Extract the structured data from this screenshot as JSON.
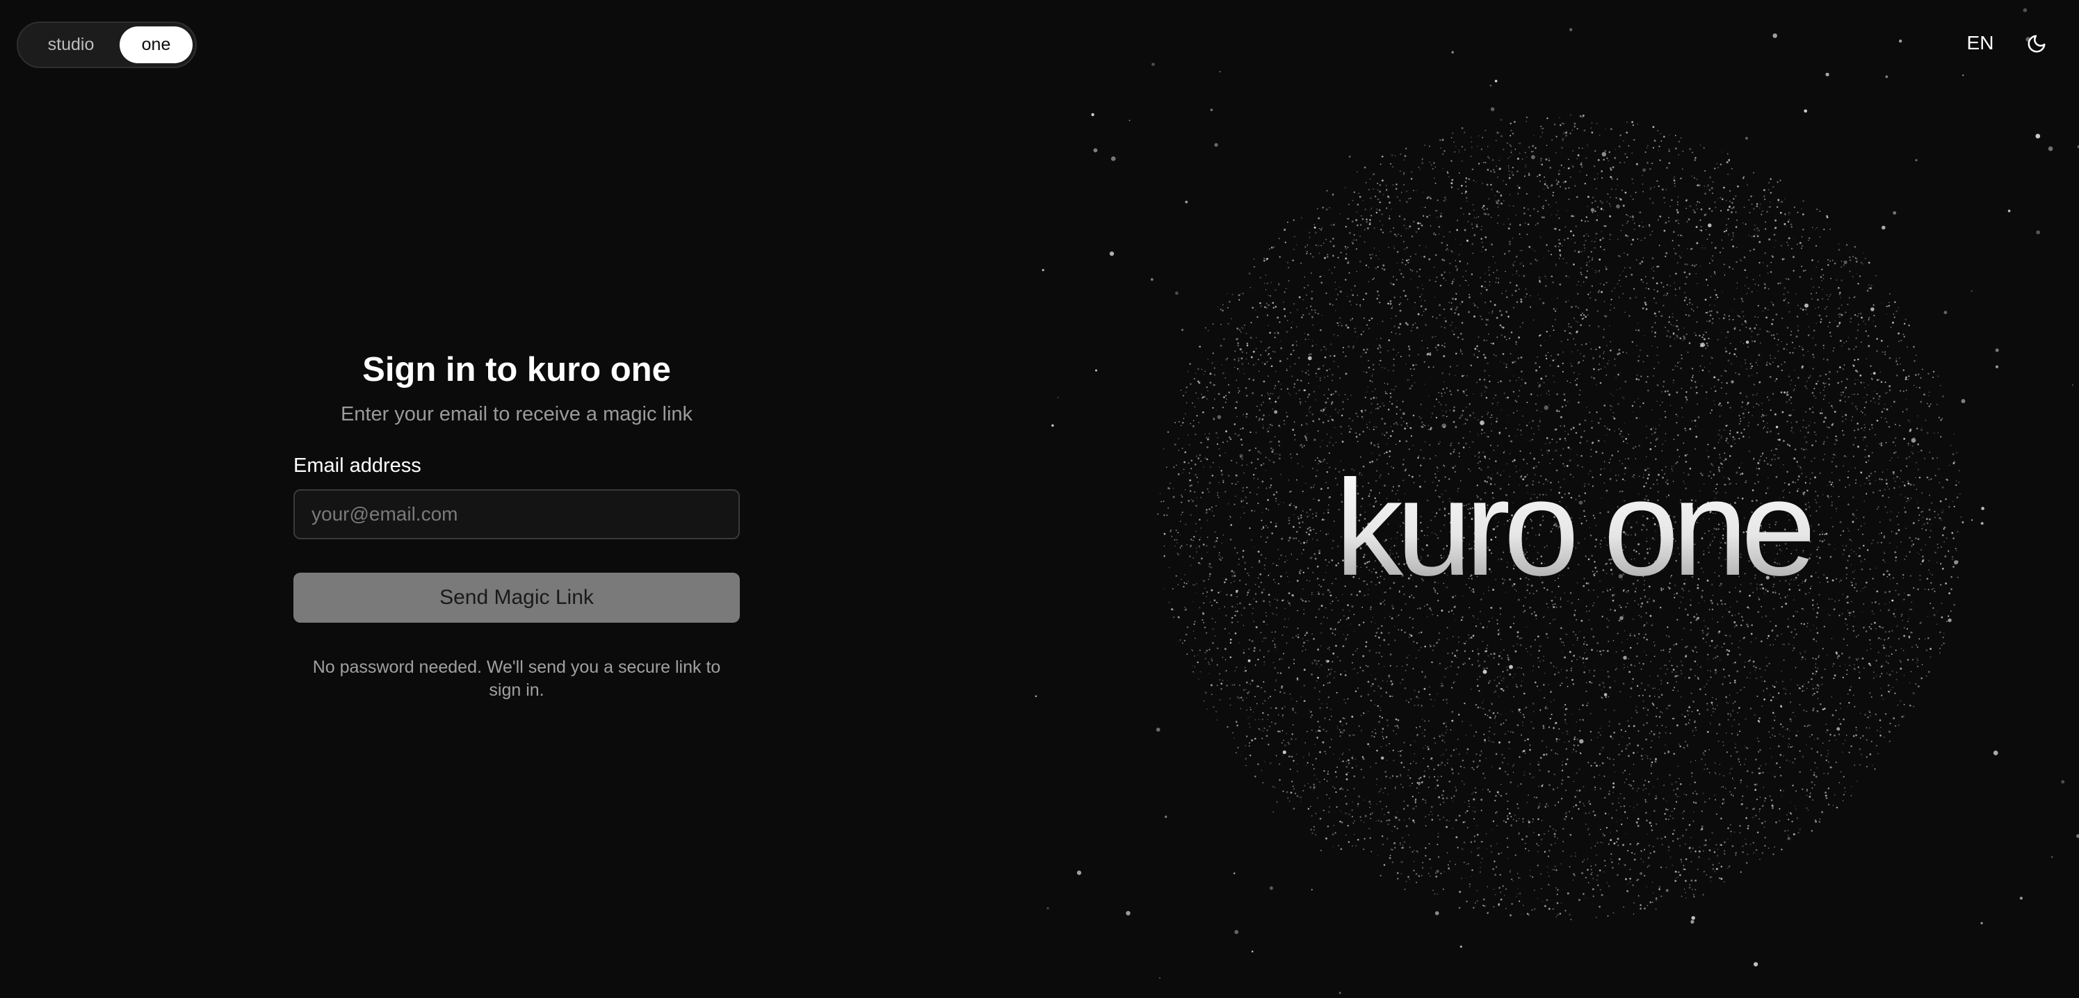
{
  "product_switch": {
    "options": [
      "studio",
      "one"
    ],
    "selected": "one"
  },
  "header": {
    "language": "EN",
    "theme_icon": "moon-icon"
  },
  "signin": {
    "title": "Sign in to kuro one",
    "subtitle": "Enter your email to receive a magic link",
    "email_label": "Email address",
    "email_placeholder": "your@email.com",
    "email_value": "",
    "submit_label": "Send Magic Link",
    "note": "No password needed. We'll send you a secure link to sign in."
  },
  "brand": {
    "wordmark": "kuro one"
  },
  "colors": {
    "background": "#0b0b0b",
    "button_disabled": "#7a7a7a",
    "input_border": "#3a3a3a",
    "muted_text": "#9a9a9a"
  }
}
